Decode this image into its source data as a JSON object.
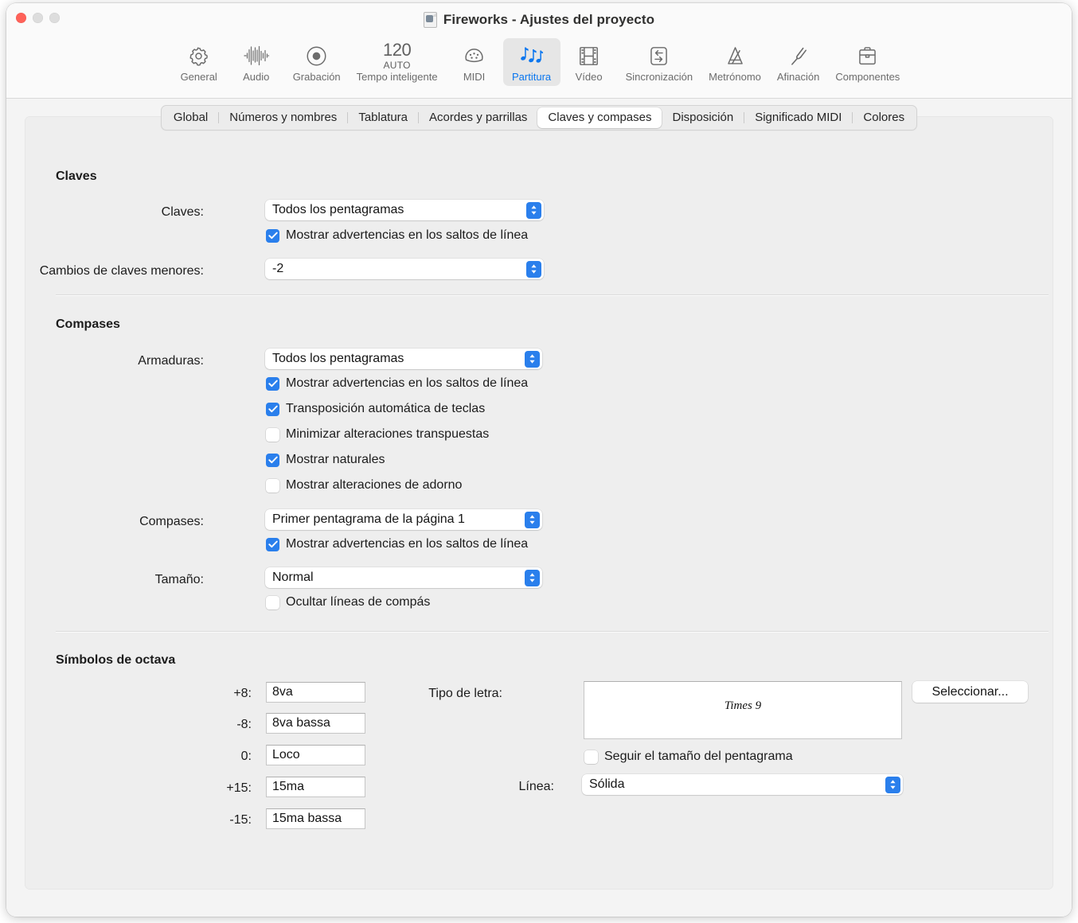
{
  "window": {
    "title": "Fireworks - Ajustes del proyecto",
    "title_icon": "document-icon",
    "traffic": {
      "close": "close-window",
      "minimize": "minimize-window",
      "zoom": "zoom-window"
    }
  },
  "toolbar": {
    "items": [
      {
        "label": "General",
        "icon": "gear-icon",
        "selected": false
      },
      {
        "label": "Audio",
        "icon": "waveform-icon",
        "selected": false
      },
      {
        "label": "Grabación",
        "icon": "record-icon",
        "selected": false
      },
      {
        "label": "Tempo inteligente",
        "icon": "tempo-icon",
        "selected": false,
        "tempo_value": "120",
        "tempo_mode": "AUTO"
      },
      {
        "label": "MIDI",
        "icon": "midi-din-icon",
        "selected": false
      },
      {
        "label": "Partitura",
        "icon": "music-notes-icon",
        "selected": true
      },
      {
        "label": "Vídeo",
        "icon": "film-icon",
        "selected": false
      },
      {
        "label": "Sincronización",
        "icon": "sync-arrows-icon",
        "selected": false
      },
      {
        "label": "Metrónomo",
        "icon": "metronome-icon",
        "selected": false
      },
      {
        "label": "Afinación",
        "icon": "tuning-fork-icon",
        "selected": false
      },
      {
        "label": "Componentes",
        "icon": "briefcase-icon",
        "selected": false
      }
    ]
  },
  "tabs": {
    "items": [
      {
        "label": "Global",
        "active": false
      },
      {
        "label": "Números y nombres",
        "active": false
      },
      {
        "label": "Tablatura",
        "active": false
      },
      {
        "label": "Acordes y parrillas",
        "active": false
      },
      {
        "label": "Claves y compases",
        "active": true
      },
      {
        "label": "Disposición",
        "active": false
      },
      {
        "label": "Significado MIDI",
        "active": false
      },
      {
        "label": "Colores",
        "active": false
      }
    ]
  },
  "claves": {
    "title": "Claves",
    "claves_label": "Claves:",
    "claves_value": "Todos los pentagramas",
    "warn_label": "Mostrar advertencias en los saltos de línea",
    "warn_checked": true,
    "minor_label": "Cambios de claves menores:",
    "minor_value": "-2"
  },
  "compases": {
    "title": "Compases",
    "armaduras_label": "Armaduras:",
    "armaduras_value": "Todos los pentagramas",
    "checks": [
      {
        "label": "Mostrar advertencias en los saltos de línea",
        "checked": true
      },
      {
        "label": "Transposición automática de teclas",
        "checked": true
      },
      {
        "label": "Minimizar alteraciones transpuestas",
        "checked": false
      },
      {
        "label": "Mostrar naturales",
        "checked": true
      },
      {
        "label": "Mostrar alteraciones de adorno",
        "checked": false
      }
    ],
    "compases_label": "Compases:",
    "compases_value": "Primer pentagrama de la página 1",
    "compases_warn_label": "Mostrar advertencias en los saltos de línea",
    "compases_warn_checked": true,
    "tamano_label": "Tamaño:",
    "tamano_value": "Normal",
    "ocultar_label": "Ocultar líneas de compás",
    "ocultar_checked": false
  },
  "octava": {
    "title": "Símbolos de octava",
    "fields": [
      {
        "label": "+8:",
        "value": "8va"
      },
      {
        "label": "-8:",
        "value": "8va bassa"
      },
      {
        "label": "0:",
        "value": "Loco"
      },
      {
        "label": "+15:",
        "value": "15ma"
      },
      {
        "label": "-15:",
        "value": "15ma bassa"
      }
    ],
    "font_label": "Tipo de letra:",
    "font_preview": "Times 9",
    "select_button": "Seleccionar...",
    "follow_label": "Seguir el tamaño del pentagrama",
    "follow_checked": false,
    "line_label": "Línea:",
    "line_value": "Sólida"
  },
  "colors": {
    "accent": "#2a7fec",
    "selected_text": "#0a76ef",
    "panel_bg": "#eeeeee",
    "toolbar_bg": "#fafafa",
    "close_dot": "#ff6259"
  }
}
